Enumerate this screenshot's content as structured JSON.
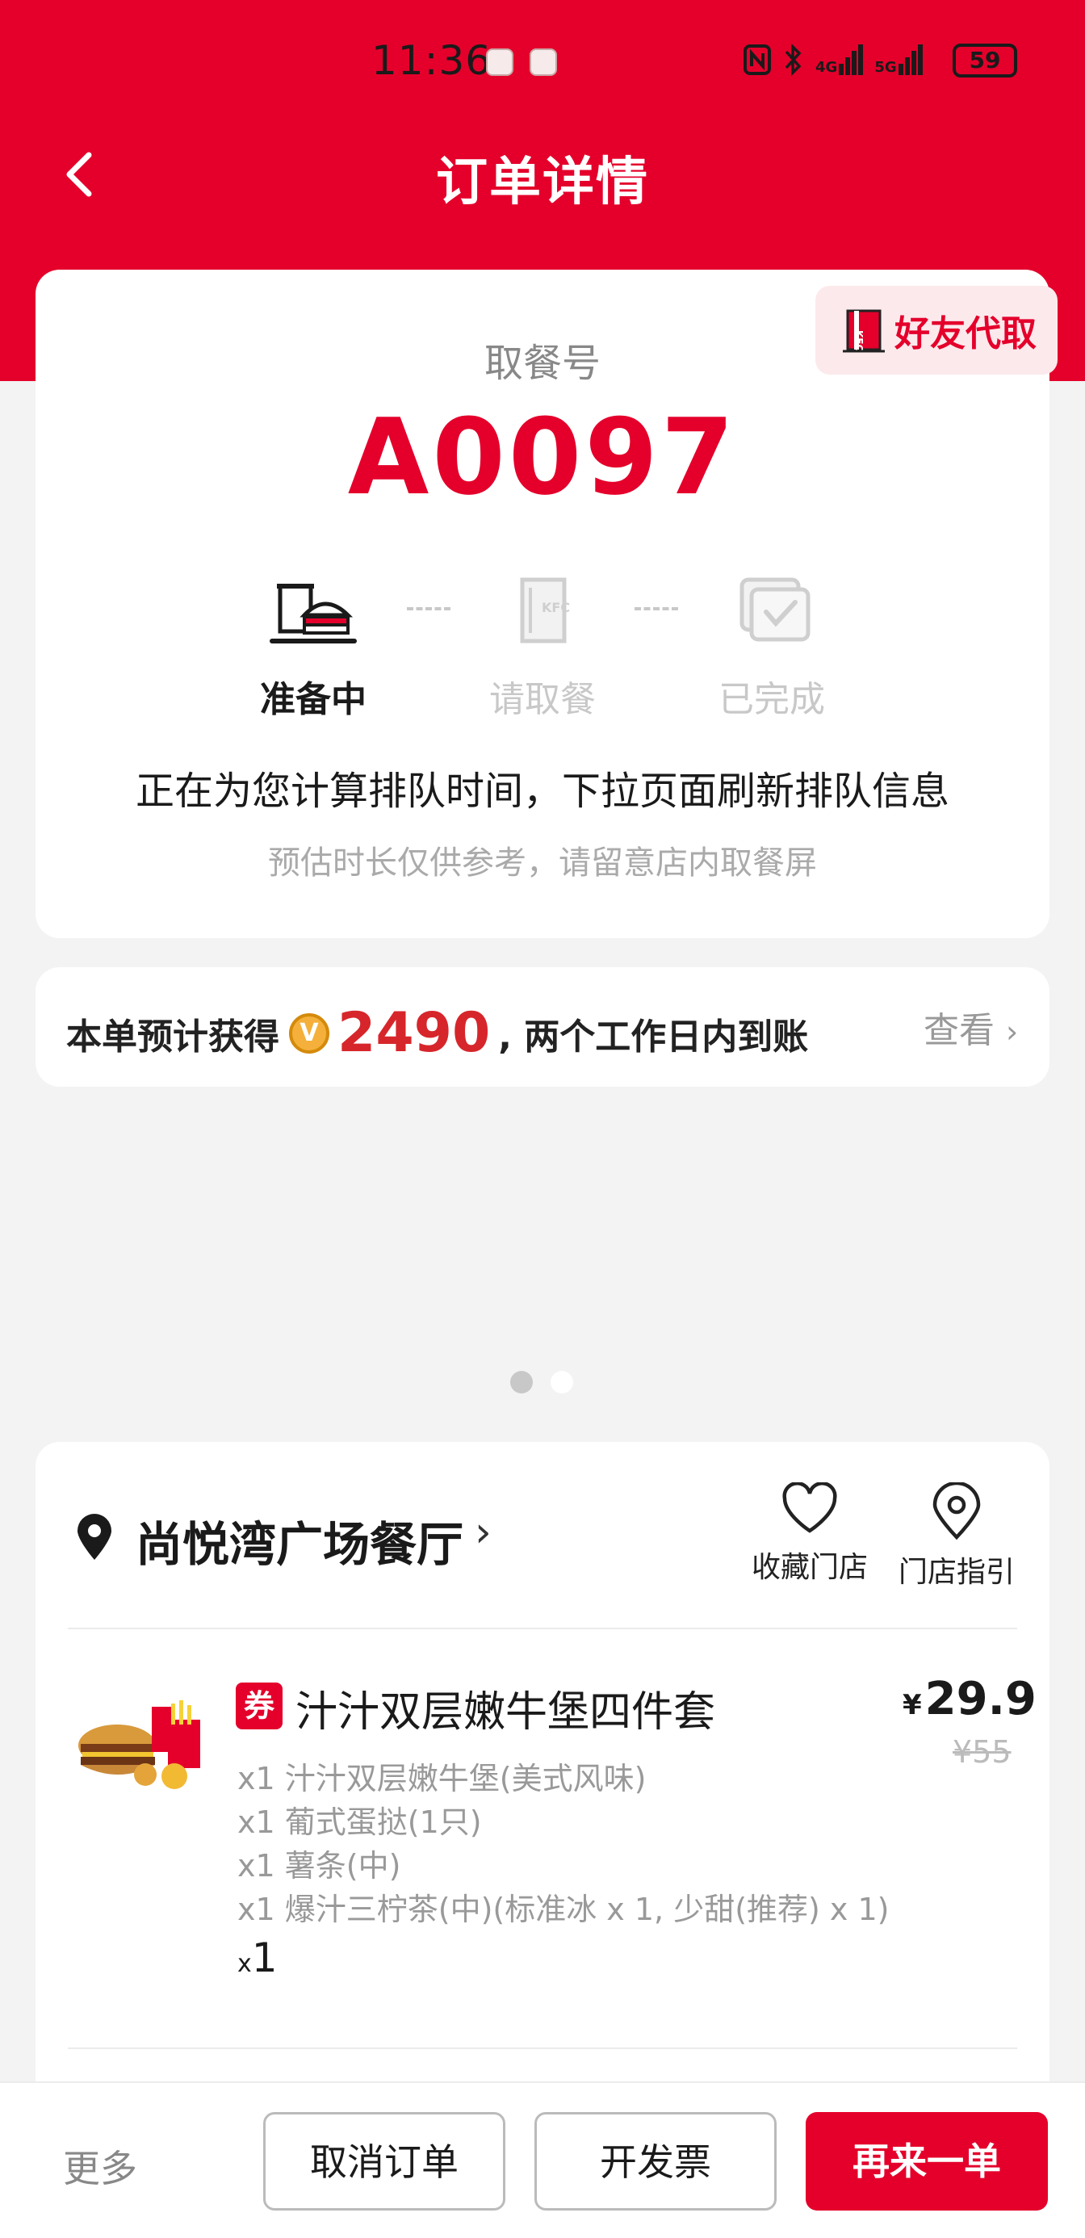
{
  "status_bar": {
    "time": "11:36",
    "network_4g": "4G",
    "network_5g": "5G",
    "battery": "59"
  },
  "nav": {
    "title": "订单详情"
  },
  "pickup": {
    "friend_tag": "好友代取",
    "label": "取餐号",
    "number": "A0097",
    "steps": [
      {
        "label": "准备中",
        "active": true,
        "icon": "tray-burger-icon"
      },
      {
        "label": "请取餐",
        "active": false,
        "icon": "kfc-bag-icon"
      },
      {
        "label": "已完成",
        "active": false,
        "icon": "check-box-icon"
      }
    ],
    "queue_message": "正在为您计算排队时间，下拉页面刷新排队信息",
    "queue_hint": "预估时长仅供参考，请留意店内取餐屏"
  },
  "points": {
    "prefix": "本单预计获得",
    "coin_letter": "V",
    "amount": "2490",
    "suffix": ", 两个工作日内到账",
    "view": "查看",
    "view_chevron": "›"
  },
  "store": {
    "name": "尚悦湾广场餐厅",
    "chevron": "›",
    "favorite_label": "收藏门店",
    "guide_label": "门店指引"
  },
  "order_item": {
    "badge": "券",
    "name": "汁汁双层嫩牛堡四件套",
    "currency": "¥",
    "price": "29.9",
    "original_price": "¥55",
    "contents": [
      "x1 汁汁双层嫩牛堡(美式风味)",
      "x1 葡式蛋挞(1只)",
      "x1 薯条(中)",
      "x1 爆汁三柠茶(中)(标准冰 x 1, 少甜(推荐) x 1)"
    ],
    "qty_prefix": "x",
    "qty": "1"
  },
  "bottom_bar": {
    "more": "更多",
    "cancel": "取消订单",
    "invoice": "开发票",
    "reorder": "再来一单"
  },
  "colors": {
    "brand_red": "#e4002b",
    "page_bg": "#f3f3f3",
    "coin_gold": "#f4b03a"
  }
}
